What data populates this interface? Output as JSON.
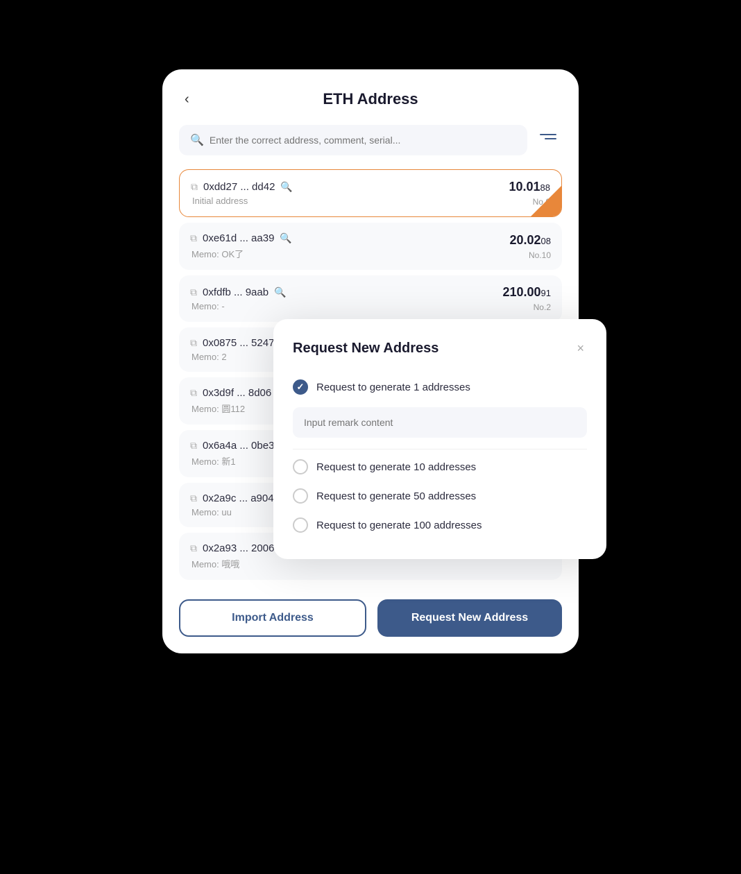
{
  "page": {
    "title": "ETH Address",
    "back_label": "‹"
  },
  "search": {
    "placeholder": "Enter the correct address, comment, serial..."
  },
  "addresses": [
    {
      "hash": "0xdd27 ... dd42",
      "memo": "Initial address",
      "amount_main": "10.01",
      "amount_small": "88",
      "no": "No.0",
      "active": true
    },
    {
      "hash": "0xe61d ... aa39",
      "memo": "Memo: OK了",
      "amount_main": "20.02",
      "amount_small": "08",
      "no": "No.10",
      "active": false
    },
    {
      "hash": "0xfdfb ... 9aab",
      "memo": "Memo: -",
      "amount_main": "210.00",
      "amount_small": "91",
      "no": "No.2",
      "active": false
    },
    {
      "hash": "0x0875 ... 5247",
      "memo": "Memo: 2",
      "amount_main": "",
      "amount_small": "",
      "no": "",
      "active": false
    },
    {
      "hash": "0x3d9f ... 8d06",
      "memo": "Memo: 圆112",
      "amount_main": "",
      "amount_small": "",
      "no": "",
      "active": false
    },
    {
      "hash": "0x6a4a ... 0be3",
      "memo": "Memo: 新1",
      "amount_main": "",
      "amount_small": "",
      "no": "",
      "active": false
    },
    {
      "hash": "0x2a9c ... a904",
      "memo": "Memo: uu",
      "amount_main": "",
      "amount_small": "",
      "no": "",
      "active": false
    },
    {
      "hash": "0x2a93 ... 2006",
      "memo": "Memo: 哦哦",
      "amount_main": "",
      "amount_small": "",
      "no": "",
      "active": false
    }
  ],
  "buttons": {
    "import": "Import Address",
    "request": "Request New Address"
  },
  "modal": {
    "title": "Request New Address",
    "close": "×",
    "remark_placeholder": "Input remark content",
    "options": [
      {
        "label": "Request to generate 1 addresses",
        "checked": true
      },
      {
        "label": "Request to generate 10 addresses",
        "checked": false
      },
      {
        "label": "Request to generate 50 addresses",
        "checked": false
      },
      {
        "label": "Request to generate 100 addresses",
        "checked": false
      }
    ]
  }
}
